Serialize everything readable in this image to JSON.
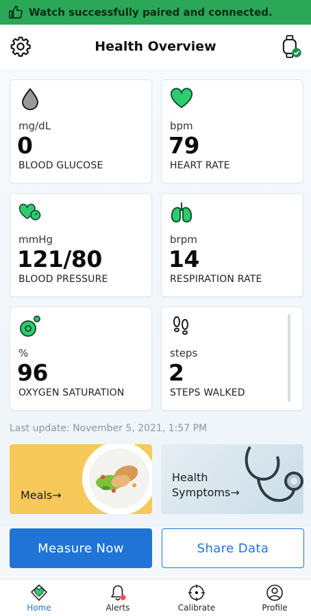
{
  "banner": {
    "text": "Watch successfully paired and connected.",
    "icon": "thumbs-up-icon"
  },
  "header": {
    "title": "Health Overview",
    "left_icon": "gear-icon",
    "right_icon": "watch-connected-icon"
  },
  "metrics": [
    {
      "icon": "blood-drop-icon",
      "unit": "mg/dL",
      "value": "0",
      "label": "BLOOD GLUCOSE"
    },
    {
      "icon": "heart-icon",
      "unit": "bpm",
      "value": "79",
      "label": "HEART RATE"
    },
    {
      "icon": "heart-gauge-icon",
      "unit": "mmHg",
      "value": "121/80",
      "label": "BLOOD PRESSURE"
    },
    {
      "icon": "lungs-icon",
      "unit": "brpm",
      "value": "14",
      "label": "RESPIRATION RATE"
    },
    {
      "icon": "oxygen-icon",
      "unit": "%",
      "value": "96",
      "label": "OXYGEN SATURATION"
    },
    {
      "icon": "footsteps-icon",
      "unit": "steps",
      "value": "2",
      "label": "STEPS WALKED"
    }
  ],
  "last_update": "Last update: November 5, 2021, 1:57 PM",
  "tiles": {
    "meals": {
      "label": "Meals→"
    },
    "symptoms": {
      "line1": "Health",
      "line2": "Symptoms→"
    }
  },
  "actions": {
    "measure": "Measure Now",
    "share": "Share Data"
  },
  "tabs": [
    {
      "label": "Home",
      "icon": "home-heart-icon",
      "active": true
    },
    {
      "label": "Alerts",
      "icon": "bell-icon",
      "active": false
    },
    {
      "label": "Calibrate",
      "icon": "crosshair-icon",
      "active": false
    },
    {
      "label": "Profile",
      "icon": "profile-icon",
      "active": false
    }
  ],
  "colors": {
    "banner": "#2aa858",
    "accent_green": "#2ecc71",
    "primary_blue": "#1f74d6",
    "alert_dot": "#ff4d5e"
  }
}
